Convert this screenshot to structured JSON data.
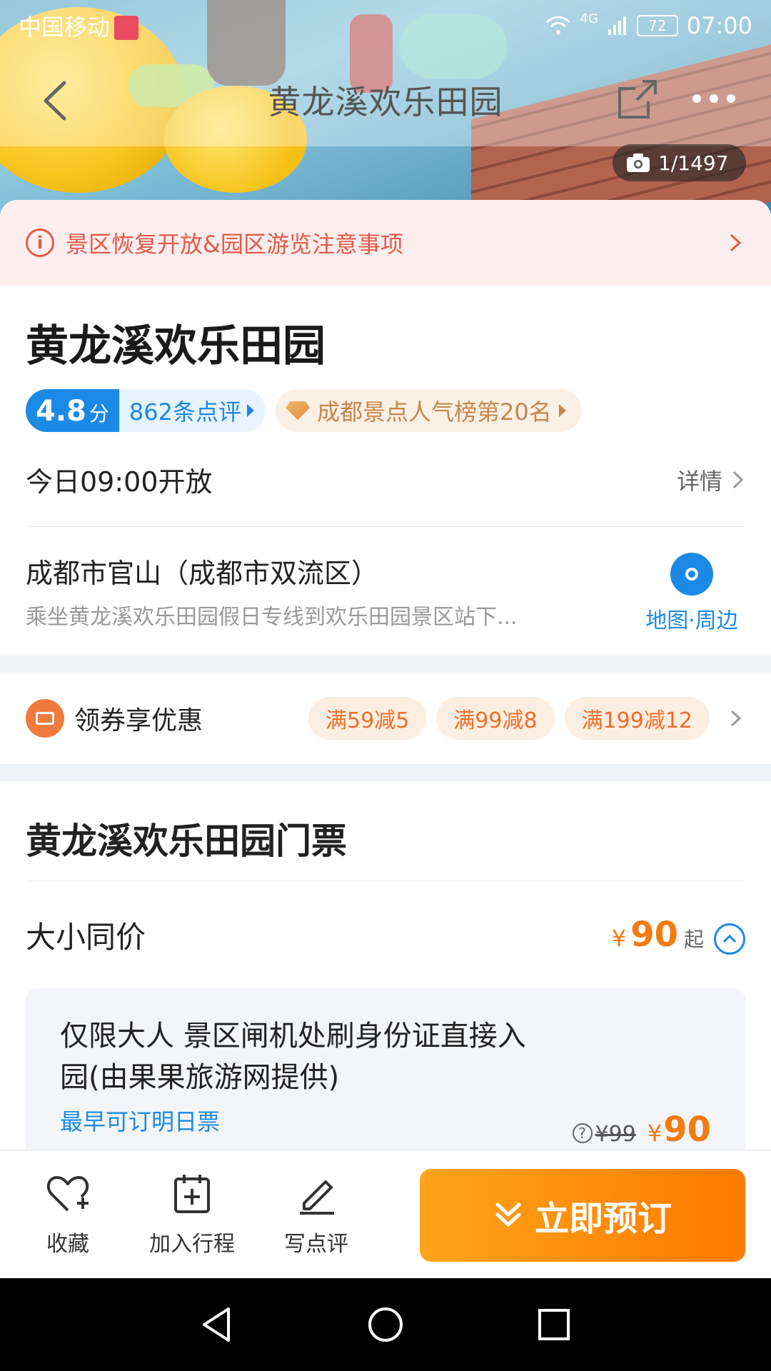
{
  "status_bar": {
    "carrier": "中国移动",
    "network": "4G",
    "battery": "72",
    "time": "07:00"
  },
  "navbar": {
    "title": "黄龙溪欢乐田园"
  },
  "gallery": {
    "photo_count": "1/1497"
  },
  "notice": {
    "text": "景区恢复开放&园区游览注意事项"
  },
  "attraction": {
    "name": "黄龙溪欢乐田园",
    "rating_score": "4.8",
    "rating_unit": "分",
    "review_count": "862条点评",
    "rank": "成都景点人气榜第20名",
    "hours": "今日09:00开放",
    "hours_detail": "详情",
    "address": "成都市官山（成都市双流区）",
    "transport": "乘坐黄龙溪欢乐田园假日专线到欢乐田园景区站下...",
    "map_label": "地图·周边"
  },
  "coupons": {
    "label": "领券享优惠",
    "items": [
      "满59减5",
      "满99减8",
      "满199减12"
    ]
  },
  "tickets": {
    "section_title": "黄龙溪欢乐田园门票",
    "category": "大小同价",
    "currency": "¥",
    "from_price": "90",
    "from_suffix": "起",
    "item": {
      "description": "仅限大人  景区闸机处刷身份证直接入园(由果果旅游网提供)",
      "booking_note": "最早可订明日票",
      "original_price": "¥99",
      "price": "90"
    }
  },
  "action_bar": {
    "favorite": "收藏",
    "add_itinerary": "加入行程",
    "write_review": "写点评",
    "book_now": "立即预订"
  },
  "colors": {
    "accent_blue": "#1b8ae6",
    "price_orange": "#f57a10",
    "notice_red": "#e35a4a",
    "book_orange": "#ff8a00"
  }
}
